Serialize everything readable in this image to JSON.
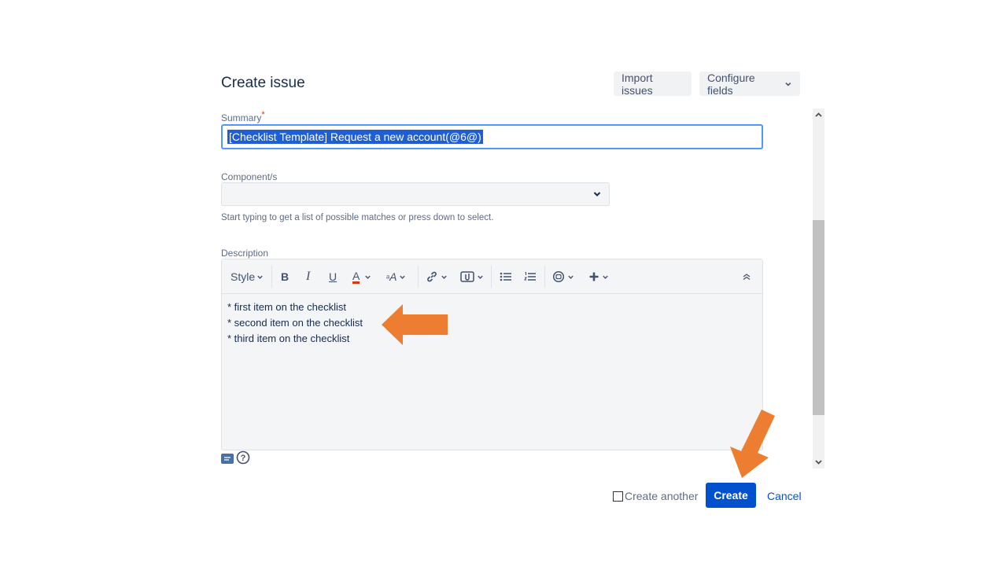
{
  "dialog": {
    "title": "Create issue",
    "import_label": "Import issues",
    "configure_label": "Configure fields"
  },
  "summary": {
    "label": "Summary",
    "required_mark": "*",
    "value": "[Checklist Template] Request a new account(@6@)"
  },
  "component": {
    "label": "Component/s",
    "hint": "Start typing to get a list of possible matches or press down to select."
  },
  "description": {
    "label": "Description",
    "style_label": "Style",
    "lines": [
      "* first item on the checklist",
      "* second item on the checklist",
      "* third item on the checklist"
    ]
  },
  "footer": {
    "create_another_label": "Create another",
    "create_label": "Create",
    "cancel_label": "Cancel"
  },
  "colors": {
    "primary": "#0052cc",
    "focus_border": "#4c9aff",
    "annotation_arrow": "#ed7d31",
    "required": "#de350b"
  },
  "icons": [
    "chevron-down-icon",
    "bold-icon",
    "italic-icon",
    "underline-icon",
    "text-color-icon",
    "text-size-icon",
    "link-icon",
    "attachment-icon",
    "bullet-list-icon",
    "numbered-list-icon",
    "emoji-icon",
    "plus-icon",
    "collapse-icon",
    "editor-mode-icon",
    "help-icon",
    "arrow-left-icon",
    "arrow-down-icon"
  ]
}
